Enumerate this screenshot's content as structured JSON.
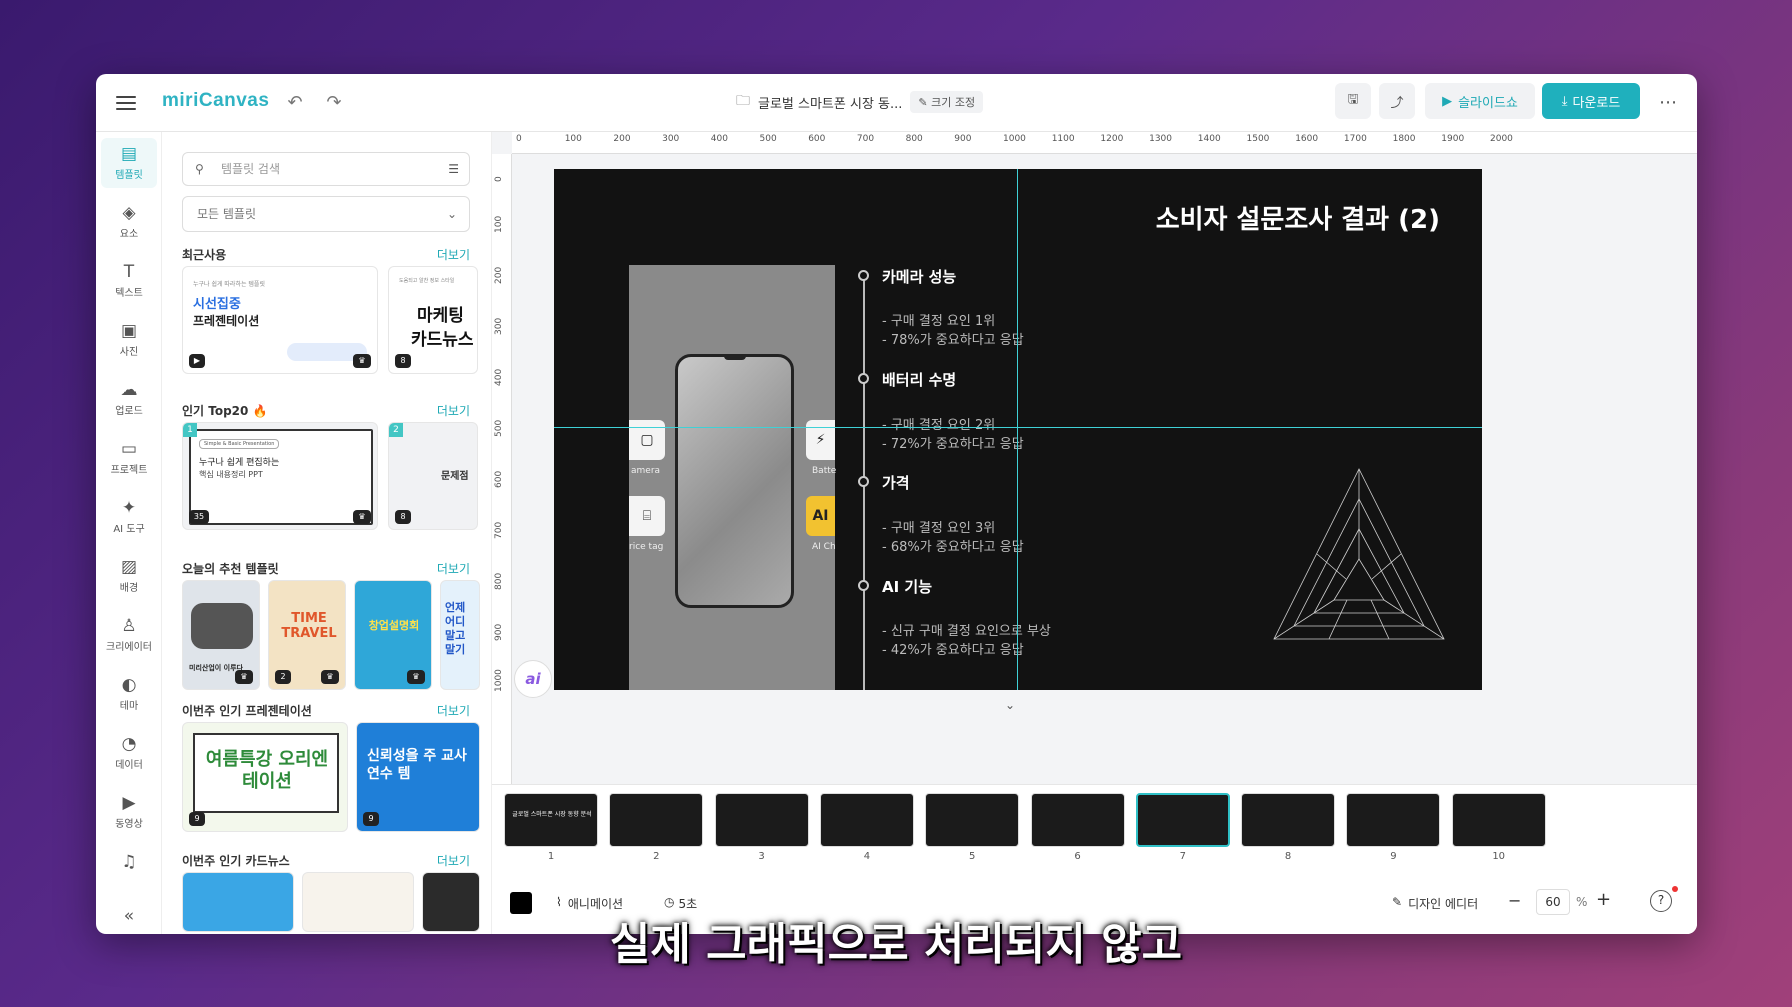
{
  "app": {
    "logo": "miriCanvas"
  },
  "header": {
    "doc_title": "글로벌 스마트폰 시장 동...",
    "resize_label": "크기 조정",
    "slideshow_label": "슬라이드쇼",
    "download_label": "다운로드"
  },
  "rail": {
    "items": [
      {
        "label": "템플릿",
        "icon": "template-icon"
      },
      {
        "label": "요소",
        "icon": "elements-icon"
      },
      {
        "label": "텍스트",
        "icon": "text-icon"
      },
      {
        "label": "사진",
        "icon": "photo-icon"
      },
      {
        "label": "업로드",
        "icon": "upload-icon"
      },
      {
        "label": "프로젝트",
        "icon": "project-icon"
      },
      {
        "label": "AI 도구",
        "icon": "ai-tools-icon"
      },
      {
        "label": "배경",
        "icon": "background-icon"
      },
      {
        "label": "크리에이터",
        "icon": "creator-icon"
      },
      {
        "label": "테마",
        "icon": "theme-icon"
      },
      {
        "label": "데이터",
        "icon": "data-icon"
      },
      {
        "label": "동영상",
        "icon": "video-icon"
      },
      {
        "label": "",
        "icon": "music-icon"
      }
    ]
  },
  "panel": {
    "search_placeholder": "템플릿 검색",
    "filter_value": "모든 템플릿",
    "more_label": "더보기",
    "sections": [
      {
        "title": "최근사용"
      },
      {
        "title": "인기 Top20 🔥"
      },
      {
        "title": "오늘의 추천 템플릿"
      },
      {
        "title": "이번주 인기 프레젠테이션"
      },
      {
        "title": "이번주 인기 카드뉴스"
      }
    ],
    "recent": [
      {
        "small": "누구나 쉽게 따라하는 템플릿",
        "line1": "시선집중",
        "line2": "프레젠테이션",
        "badge": "▶"
      },
      {
        "small": "도움되고 알찬 정보 스타일",
        "line1": "마케팅",
        "line2": "카드뉴스",
        "badge": "8"
      }
    ],
    "popular": [
      {
        "rank": "1",
        "tag": "Simple & Basic Presentation",
        "line1": "누구나 쉽게 편집하는",
        "line2": "핵심 내용정리 PPT",
        "badge": "35"
      },
      {
        "rank": "2",
        "line1": "문제점",
        "badge": "8"
      }
    ],
    "recommend": [
      {
        "text": "미리산업이 이루다",
        "badge": ""
      },
      {
        "text": "TIME TRAVEL",
        "badge": "2"
      },
      {
        "text": "창업설명회",
        "badge": ""
      },
      {
        "text": "언제 어디 말고 말기",
        "badge": ""
      }
    ],
    "presentations": [
      {
        "text": "여름특강 오리엔테이션",
        "badge": "9"
      },
      {
        "text": "신뢰성을 주 교사 연수 템",
        "badge": "9"
      }
    ],
    "cardnews": [
      {
        "text": "",
        "badge": ""
      },
      {
        "text": "",
        "badge": ""
      },
      {
        "text": "",
        "badge": ""
      }
    ]
  },
  "rulers": {
    "h": [
      "0",
      "100",
      "200",
      "300",
      "400",
      "500",
      "600",
      "700",
      "800",
      "900",
      "1000",
      "1100",
      "1200",
      "1300",
      "1400",
      "1500",
      "1600",
      "1700",
      "1800",
      "1900",
      "2000"
    ],
    "v": [
      "0",
      "100",
      "200",
      "300",
      "400",
      "500",
      "600",
      "700",
      "800",
      "900",
      "1000"
    ]
  },
  "slide": {
    "title": "소비자 설문조사 결과 (2)",
    "features": [
      {
        "name": "카메라 성능",
        "d1": "- 구매 결정 요인 1위",
        "d2": "- 78%가 중요하다고 응답"
      },
      {
        "name": "배터리 수명",
        "d1": "- 구매 결정 요인 2위",
        "d2": "- 72%가 중요하다고 응답"
      },
      {
        "name": "가격",
        "d1": "- 구매 결정 요인 3위",
        "d2": "- 68%가 중요하다고 응답"
      },
      {
        "name": "AI 기능",
        "d1": "- 신규 구매 결정 요인으로 부상",
        "d2": "- 42%가 중요하다고 응답"
      }
    ],
    "icon_labels": [
      "amera",
      "Batte",
      "rice tag",
      "AI Ch"
    ],
    "ai_label": "ai"
  },
  "thumbnails": [
    "1",
    "2",
    "3",
    "4",
    "5",
    "6",
    "7",
    "8",
    "9",
    "10"
  ],
  "thumbnail_1_title": "글로벌 스마트폰 시장 동향 분석",
  "bottom": {
    "animation_label": "애니메이션",
    "duration_label": "5초",
    "design_editor_label": "디자인 에디터",
    "zoom": "60",
    "zoom_unit": "%"
  },
  "caption": "실제 그래픽으로 처리되지 않고",
  "colors": {
    "accent": "#1fb0bd",
    "guide": "#3fd1d6",
    "slide_bg": "#121212"
  }
}
